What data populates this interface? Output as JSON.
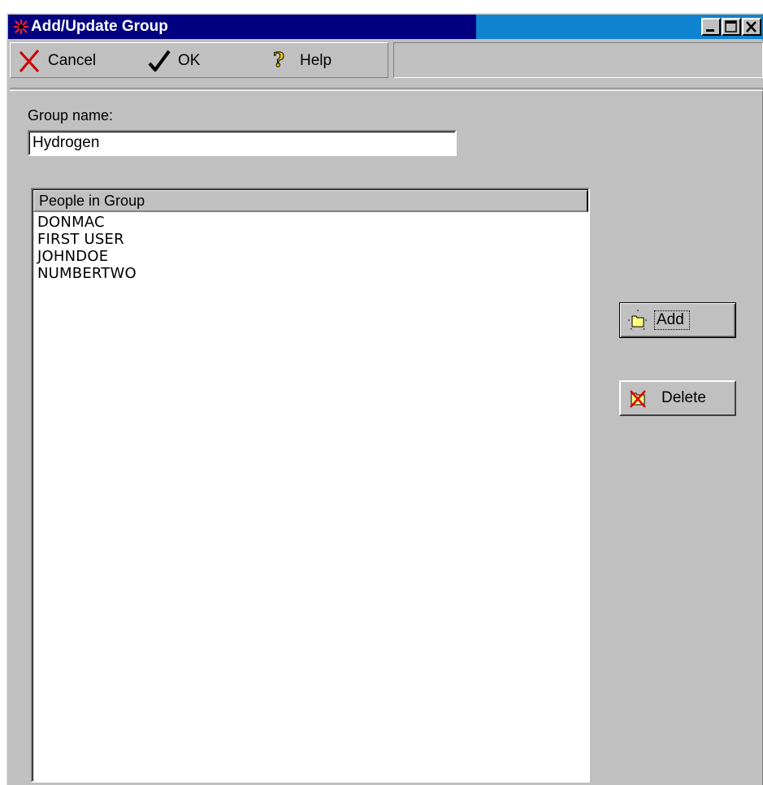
{
  "window": {
    "title": "Add/Update Group"
  },
  "toolbar": {
    "cancel_label": "Cancel",
    "ok_label": "OK",
    "help_label": "Help"
  },
  "form": {
    "group_name_label": "Group name:",
    "group_name_value": "Hydrogen"
  },
  "list": {
    "header": "People in Group",
    "items": [
      "DONMAC",
      "FIRST USER",
      "JOHNDOE",
      "NUMBERTWO"
    ]
  },
  "buttons": {
    "add_label": "Add",
    "delete_label": "Delete"
  },
  "colors": {
    "titlebar": "#000080",
    "titlebar_right": "#1084d0",
    "face": "#c0c0c0"
  },
  "icons": {
    "title": "app-icon",
    "cancel": "x-cross-icon",
    "ok": "checkmark-icon",
    "help": "question-mark-icon",
    "add": "add-folder-icon",
    "delete": "delete-folder-icon"
  }
}
